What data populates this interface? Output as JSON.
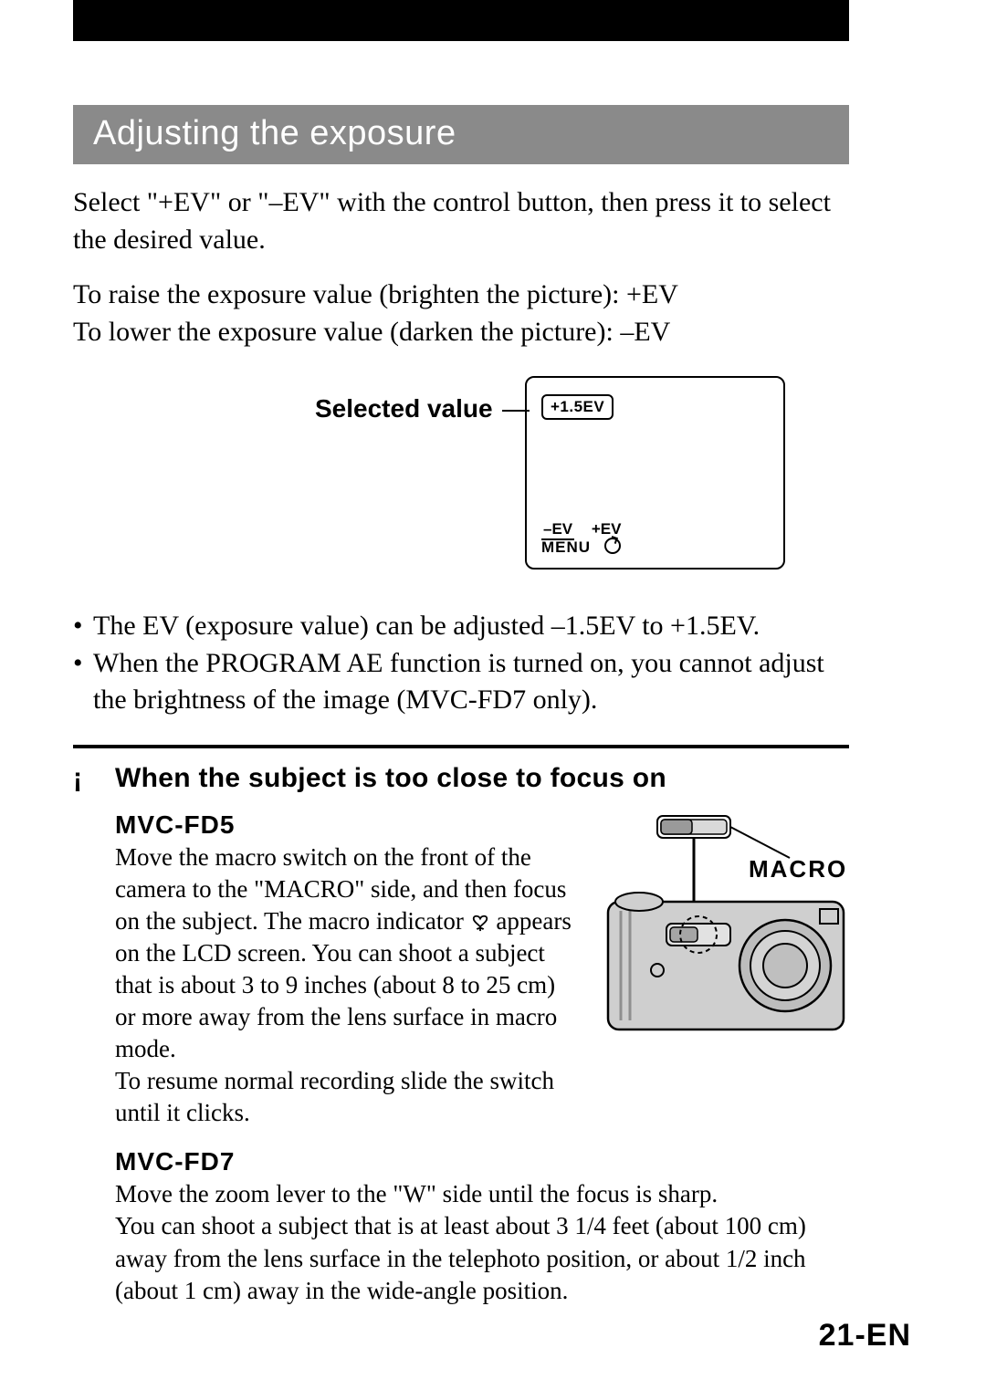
{
  "section_heading": "Adjusting the exposure",
  "intro": "Select \"+EV\" or \"–EV\" with the control button, then press it to select the desired value.",
  "raise_line": "To raise the exposure value (brighten the picture):   +EV",
  "lower_line": "To lower the exposure value (darken the picture):    –EV",
  "lcd": {
    "label": "Selected value",
    "ev_badge": "+1.5EV",
    "neg": "–EV",
    "pos": "+EV",
    "menu": "MENU"
  },
  "bullets": [
    "The EV (exposure value) can be adjusted –1.5EV to +1.5EV.",
    "When the PROGRAM AE function is turned on, you cannot adjust the brightness of the image (MVC-FD7 only)."
  ],
  "macro_section": {
    "bang": "¡",
    "heading": "When the subject is too close to focus on",
    "fd5": {
      "name": "MVC-FD5",
      "body_a": "Move the macro switch on the front of the camera to the \"MACRO\" side, and then focus on the subject. The macro indicator ",
      "body_b": " appears on the LCD screen. You can shoot a subject that is about 3 to 9 inches (about 8 to 25 cm) or more away from the lens surface in macro mode.",
      "body_c": "To resume normal recording slide the switch until it clicks.",
      "figure_label": "MACRO"
    },
    "fd7": {
      "name": "MVC-FD7",
      "body1": "Move the zoom lever to the \"W\" side until the focus is sharp.",
      "body2": "You can shoot a subject that is at least about 3 1/4 feet (about 100 cm) away from the lens surface in the telephoto position, or  about 1/2 inch (about 1 cm) away in the wide-angle position."
    }
  },
  "page_number": "21-EN"
}
